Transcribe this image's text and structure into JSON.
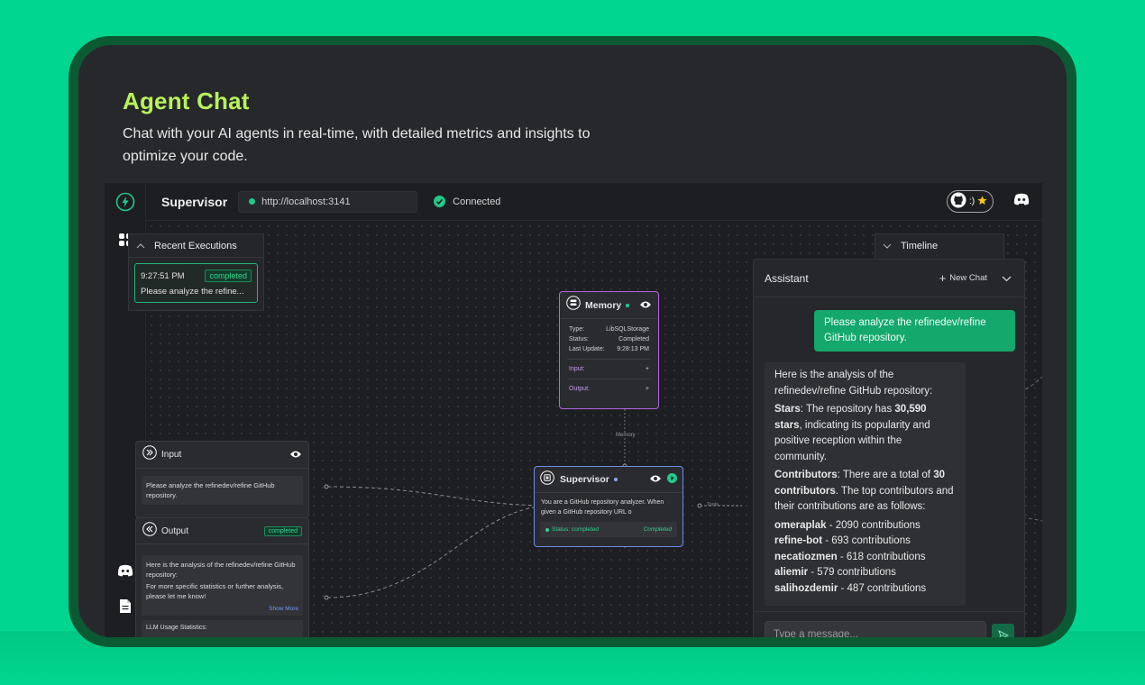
{
  "hero": {
    "title": "Agent Chat",
    "subtitle": "Chat with your AI agents in real-time, with detailed metrics and insights to optimize your code."
  },
  "topbar": {
    "title": "Supervisor",
    "url": "http://localhost:3141",
    "status": "Connected",
    "github_pill": ":)"
  },
  "recent": {
    "title": "Recent Executions",
    "items": [
      {
        "time": "9:27:51 PM",
        "status": "completed",
        "text": "Please analyze the refine..."
      }
    ]
  },
  "timeline": {
    "title": "Timeline"
  },
  "memory_node": {
    "title": "Memory",
    "type_label": "Type:",
    "type_value": "LibSQLStorage",
    "status_label": "Status:",
    "status_value": "Completed",
    "update_label": "Last Update:",
    "update_value": "9:28:13 PM",
    "input_label": "Input:",
    "output_label": "Output:"
  },
  "edge_label": "Memory",
  "tools_label": "Tools",
  "supervisor_node": {
    "title": "Supervisor",
    "prompt": "You are a GitHub repository analyzer. When given a GitHub repository URL o",
    "status": "Status: completed",
    "status_right": "Completed"
  },
  "input_node": {
    "title": "Input",
    "text": "Please analyze the refinedev/refine GitHub repository."
  },
  "output_node": {
    "title": "Output",
    "badge": "completed",
    "line1": "Here is the analysis of the refinedev/refine GitHub repository:",
    "line2": "For more specific statistics or further analysis, please let me know!",
    "show_more": "Show More",
    "llm_stats": "LLM Usage Statistics:"
  },
  "chat": {
    "title": "Assistant",
    "new_chat": "New Chat",
    "user_message": "Please analyze the refinedev/refine GitHub repository.",
    "assistant": {
      "intro": "Here is the analysis of the refinedev/refine GitHub repository:",
      "stars_label": "Stars",
      "stars_pre": ": The repository has ",
      "stars_value": "30,590",
      "stars_bold2": "stars",
      "stars_post": ", indicating its popularity and positive reception within the community.",
      "contrib_label": "Contributors",
      "contrib_pre": ": There are a total of ",
      "contrib_value": "30",
      "contrib_bold2": "contributors",
      "contrib_post": ". The top contributors and their contributions are as follows:",
      "contributors": [
        {
          "name": "omeraplak",
          "count": " - 2090 contributions"
        },
        {
          "name": "refine-bot",
          "count": " - 693 contributions"
        },
        {
          "name": "necatiozmen",
          "count": " - 618 contributions"
        },
        {
          "name": "aliemir",
          "count": " - 579 contributions"
        },
        {
          "name": "salihozdemir",
          "count": " - 487 contributions"
        }
      ]
    },
    "input_placeholder": "Type a message..."
  },
  "colors": {
    "background": "#00d68f",
    "frame": "#0c5a33",
    "accent": "#b8f25b",
    "brand_green": "#22c98a",
    "memory_border": "#b366e6",
    "supervisor_border": "#6d8cf0"
  },
  "icons": {
    "rail": [
      "lightning-icon",
      "grid-icon",
      "discord-icon",
      "document-icon"
    ],
    "topbar": [
      "github-icon",
      "star-icon",
      "discord-icon"
    ]
  }
}
